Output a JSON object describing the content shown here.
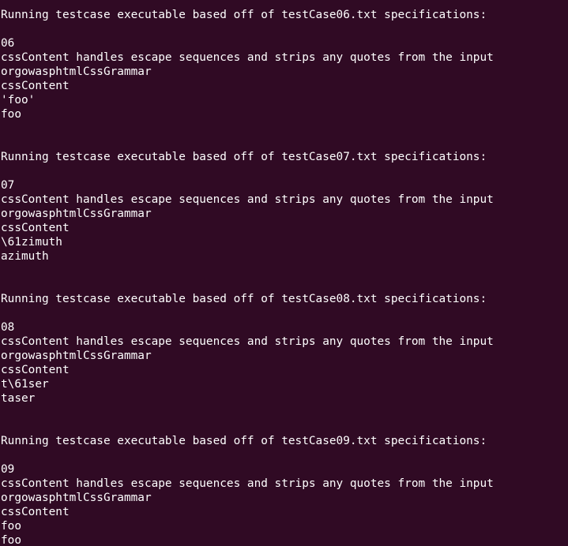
{
  "theme": {
    "background": "#300a24",
    "foreground": "#ffffff"
  },
  "terminal": {
    "lines": [
      "Running testcase executable based off of testCase06.txt specifications:",
      "",
      "06",
      "cssContent handles escape sequences and strips any quotes from the input",
      "orgowasphtmlCssGrammar",
      "cssContent",
      "'foo'",
      "foo",
      "",
      "",
      "Running testcase executable based off of testCase07.txt specifications:",
      "",
      "07",
      "cssContent handles escape sequences and strips any quotes from the input",
      "orgowasphtmlCssGrammar",
      "cssContent",
      "\\61zimuth",
      "azimuth",
      "",
      "",
      "Running testcase executable based off of testCase08.txt specifications:",
      "",
      "08",
      "cssContent handles escape sequences and strips any quotes from the input",
      "orgowasphtmlCssGrammar",
      "cssContent",
      "t\\61ser",
      "taser",
      "",
      "",
      "Running testcase executable based off of testCase09.txt specifications:",
      "",
      "09",
      "cssContent handles escape sequences and strips any quotes from the input",
      "orgowasphtmlCssGrammar",
      "cssContent",
      "foo",
      "foo"
    ]
  }
}
